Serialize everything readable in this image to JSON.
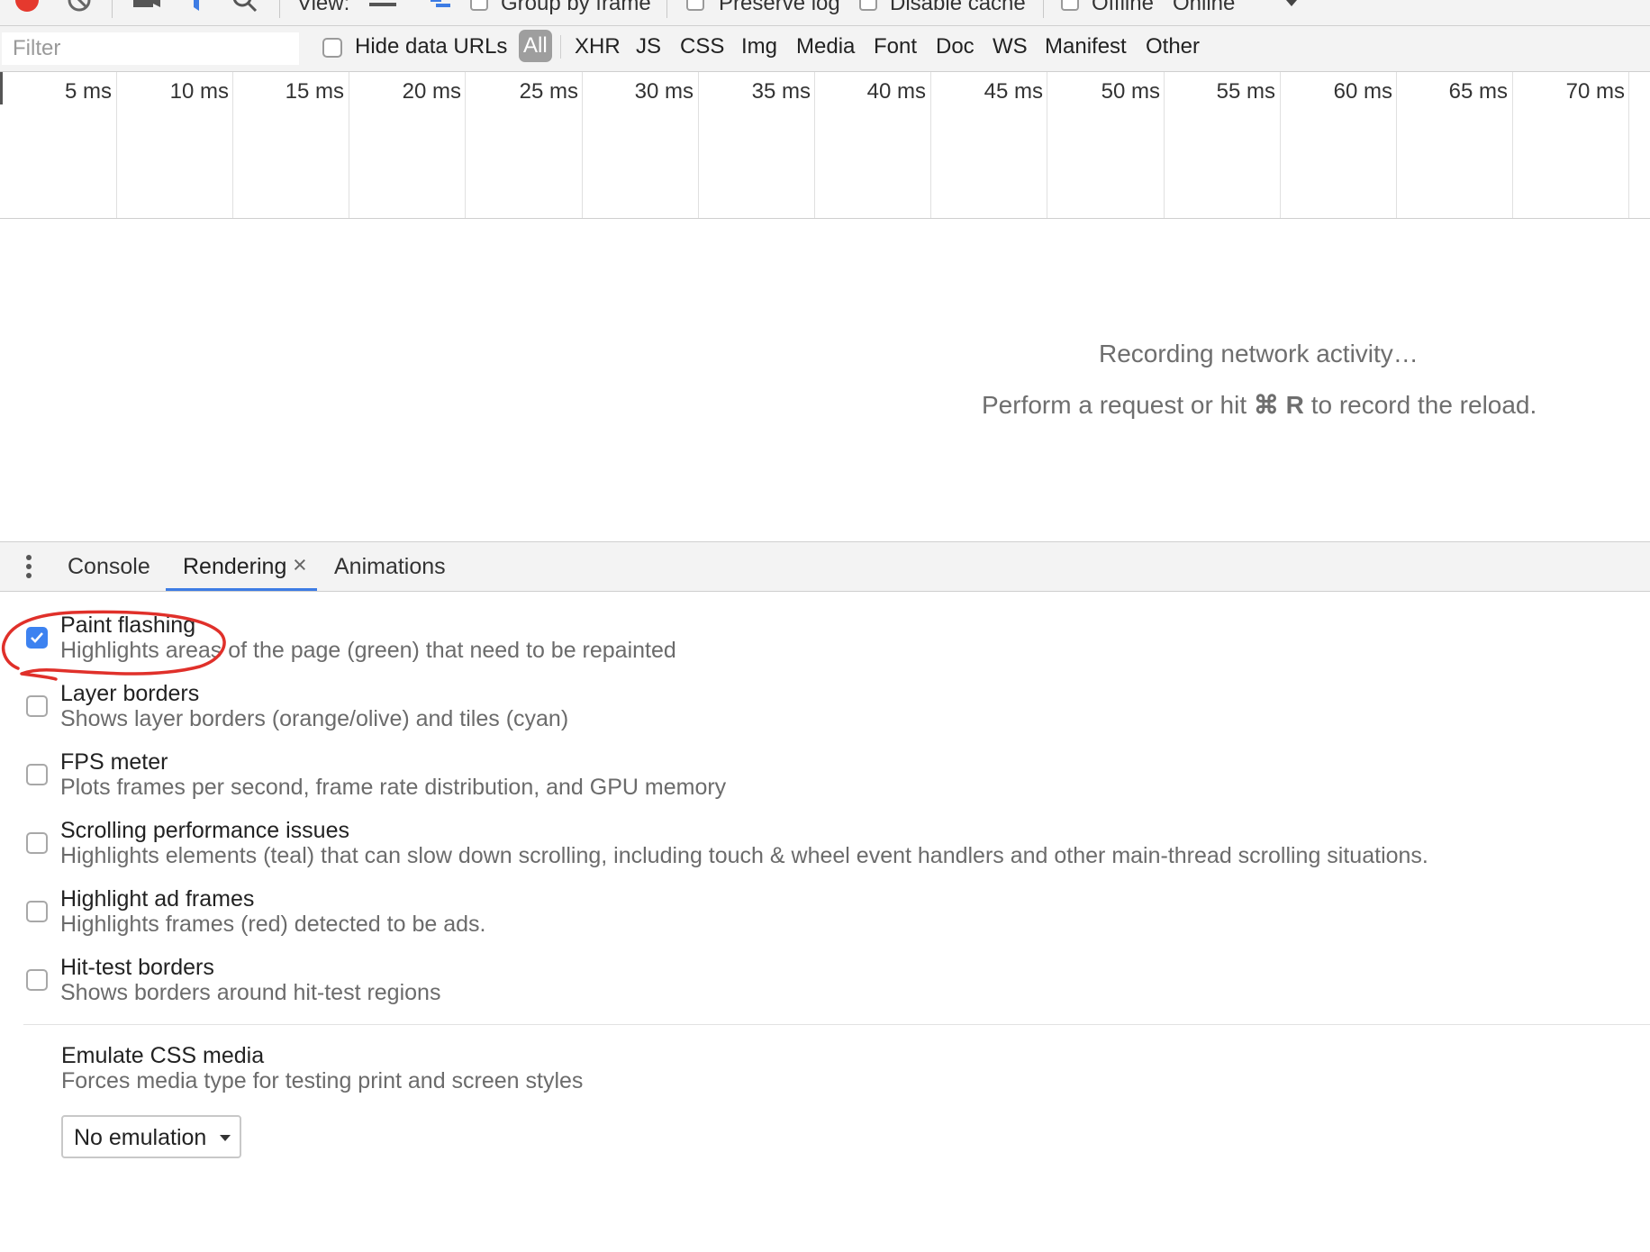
{
  "toolbar": {
    "view_label": "View:",
    "group_by_frame": "Group by frame",
    "preserve_log": "Preserve log",
    "disable_cache": "Disable cache",
    "offline": "Offline",
    "throttling": "Online"
  },
  "filterbar": {
    "filter_placeholder": "Filter",
    "hide_data_urls": "Hide data URLs",
    "types": [
      "All",
      "XHR",
      "JS",
      "CSS",
      "Img",
      "Media",
      "Font",
      "Doc",
      "WS",
      "Manifest",
      "Other"
    ],
    "active_type": "All"
  },
  "timeline": {
    "ticks": [
      "5 ms",
      "10 ms",
      "15 ms",
      "20 ms",
      "25 ms",
      "30 ms",
      "35 ms",
      "40 ms",
      "45 ms",
      "50 ms",
      "55 ms",
      "60 ms",
      "65 ms",
      "70 ms"
    ]
  },
  "recording": {
    "line1": "Recording network activity…",
    "line2_prefix": "Perform a request or hit",
    "line2_key": "⌘ R",
    "line2_suffix": "to record the reload."
  },
  "drawer": {
    "tabs": [
      "Console",
      "Rendering",
      "Animations"
    ],
    "active_tab": "Rendering",
    "close_glyph": "×"
  },
  "rendering": {
    "options": [
      {
        "title": "Paint flashing",
        "desc": "Highlights areas of the page (green) that need to be repainted",
        "checked": true
      },
      {
        "title": "Layer borders",
        "desc": "Shows layer borders (orange/olive) and tiles (cyan)",
        "checked": false
      },
      {
        "title": "FPS meter",
        "desc": "Plots frames per second, frame rate distribution, and GPU memory",
        "checked": false
      },
      {
        "title": "Scrolling performance issues",
        "desc": "Highlights elements (teal) that can slow down scrolling, including touch & wheel event handlers and other main-thread scrolling situations.",
        "checked": false
      },
      {
        "title": "Highlight ad frames",
        "desc": "Highlights frames (red) detected to be ads.",
        "checked": false
      },
      {
        "title": "Hit-test borders",
        "desc": "Shows borders around hit-test regions",
        "checked": false
      }
    ],
    "emulate": {
      "title": "Emulate CSS media",
      "desc": "Forces media type for testing print and screen styles",
      "value": "No emulation"
    }
  },
  "colors": {
    "accent": "#3d7ce4",
    "annotation": "#e0302a",
    "record": "#e5392e"
  }
}
